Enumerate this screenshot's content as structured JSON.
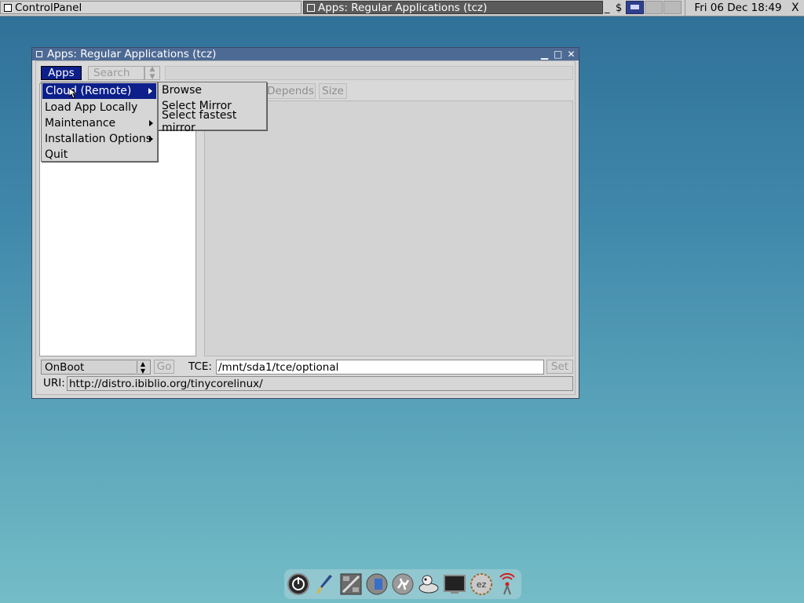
{
  "taskbar": {
    "tasks": [
      {
        "label": "ControlPanel"
      },
      {
        "label": "Apps: Regular Applications (tcz)"
      }
    ],
    "tray_min": "_",
    "tray_dollar": "$",
    "clock": "Fri 06 Dec 18:49",
    "close_glyph": "X"
  },
  "window": {
    "title": "Apps: Regular Applications (tcz)",
    "controls": {
      "minimize": "▁",
      "maximize": "□",
      "close": "✕"
    },
    "apps_button": "Apps",
    "search_button": "Search",
    "columns": {
      "depends": "Depends",
      "size": "Size"
    },
    "bottom": {
      "onboot_value": "OnBoot",
      "go_label": "Go",
      "tce_label": "TCE:",
      "tce_value": "/mnt/sda1/tce/optional",
      "set_label": "Set",
      "uri_label": "URI:",
      "uri_value": "http://distro.ibiblio.org/tinycorelinux/"
    }
  },
  "apps_menu": {
    "items": [
      {
        "label": "Cloud (Remote)",
        "submenu": true,
        "selected": true
      },
      {
        "label": "Load App Locally",
        "submenu": false
      },
      {
        "label": "Maintenance",
        "submenu": true
      },
      {
        "label": "Installation Options",
        "submenu": true
      },
      {
        "label": "Quit",
        "submenu": false
      }
    ]
  },
  "cloud_submenu": {
    "items": [
      {
        "label": "Browse"
      },
      {
        "label": "Select Mirror"
      },
      {
        "label": "Select fastest mirror"
      }
    ]
  },
  "dock": {
    "icons": [
      "power-icon",
      "brush-icon",
      "control-panel-icon",
      "mount-icon",
      "run-icon",
      "apps-icon",
      "terminal-icon",
      "ezremaster-icon",
      "wifi-icon"
    ],
    "ez_text": "ez"
  },
  "colors": {
    "title_bar": "#4d6a94",
    "selection": "#0c1f8a",
    "desktop_top": "#2f6f97",
    "desktop_bottom": "#74bcc6"
  }
}
